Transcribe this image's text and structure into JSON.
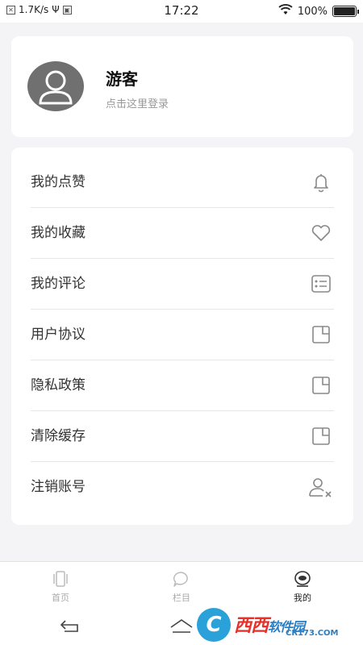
{
  "status_bar": {
    "network_speed": "1.7K/s",
    "time": "17:22",
    "battery": "100%"
  },
  "profile": {
    "username": "游客",
    "login_hint": "点击这里登录"
  },
  "menu": {
    "items": [
      {
        "label": "我的点赞",
        "icon": "bell-icon"
      },
      {
        "label": "我的收藏",
        "icon": "heart-icon"
      },
      {
        "label": "我的评论",
        "icon": "comment-list-icon"
      },
      {
        "label": "用户协议",
        "icon": "document-icon"
      },
      {
        "label": "隐私政策",
        "icon": "document-icon"
      },
      {
        "label": "清除缓存",
        "icon": "document-icon"
      },
      {
        "label": "注销账号",
        "icon": "remove-user-icon"
      }
    ]
  },
  "tab_bar": {
    "tabs": [
      {
        "label": "首页",
        "icon": "home-cards-icon",
        "active": false
      },
      {
        "label": "栏目",
        "icon": "chat-bubble-icon",
        "active": false
      },
      {
        "label": "我的",
        "icon": "profile-icon",
        "active": true
      }
    ]
  },
  "watermark": {
    "main": "西西",
    "suffix": "软件园",
    "sub": "CR173.COM"
  },
  "colors": {
    "background": "#f4f4f6",
    "card": "#ffffff",
    "avatar": "#707070",
    "hint_text": "#999999",
    "icon_gray": "#888888"
  }
}
